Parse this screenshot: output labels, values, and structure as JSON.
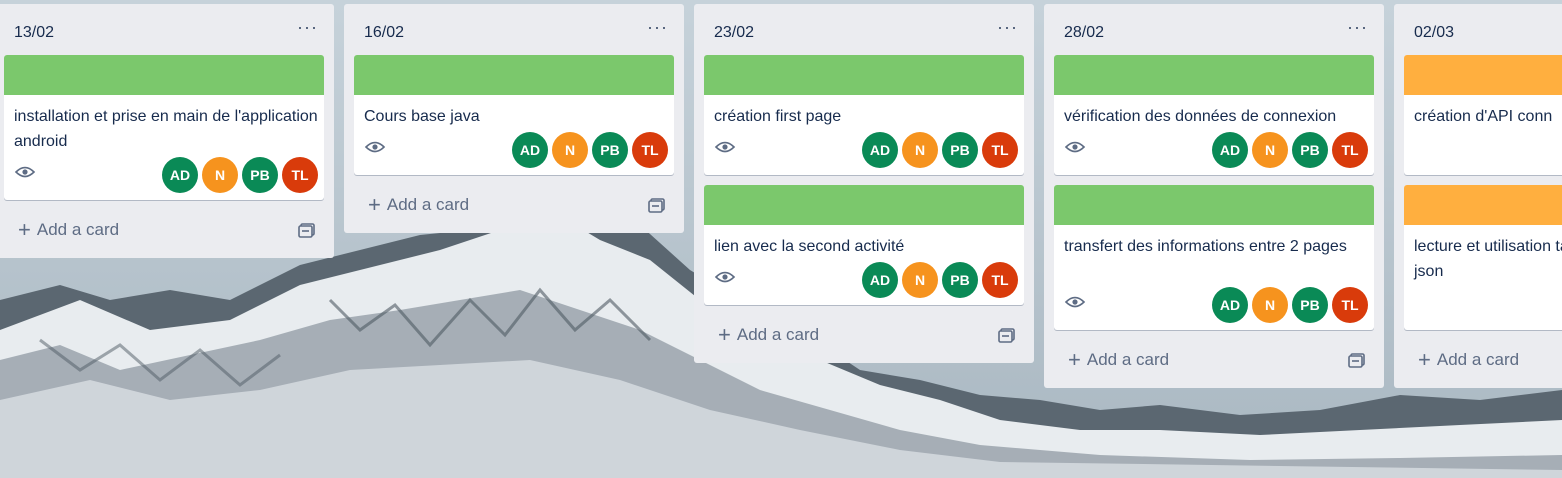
{
  "colors": {
    "label_green": "#7bc86c",
    "label_orange": "#ffaf3f",
    "avatar_ad": "#0a8a56",
    "avatar_n": "#f6931e",
    "avatar_pb": "#0a8a56",
    "avatar_tl": "#d93b0b"
  },
  "icons": {
    "menu": "more-icon",
    "watch": "eye-icon",
    "template": "card-template-icon",
    "add": "plus-icon"
  },
  "add_card_label": "Add a card",
  "menu_glyph": "···",
  "plus_glyph": "+",
  "members": [
    "AD",
    "N",
    "PB",
    "TL"
  ],
  "lists": [
    {
      "title": "13/02",
      "cards": [
        {
          "label": "green",
          "title": "installation et prise en main de l'application android"
        }
      ]
    },
    {
      "title": "16/02",
      "cards": [
        {
          "label": "green",
          "title": "Cours base java"
        }
      ]
    },
    {
      "title": "23/02",
      "cards": [
        {
          "label": "green",
          "title": "création first page"
        },
        {
          "label": "green",
          "title": "lien avec la second activité"
        }
      ]
    },
    {
      "title": "28/02",
      "cards": [
        {
          "label": "green",
          "title": "vérification des données de connexion"
        },
        {
          "label": "green",
          "title": "transfert des informations entre 2 pages"
        }
      ]
    },
    {
      "title": "02/03",
      "cards": [
        {
          "label": "orange",
          "title": "création d'API conn"
        },
        {
          "label": "orange",
          "title": "lecture et utilisation tableau json"
        }
      ]
    }
  ]
}
